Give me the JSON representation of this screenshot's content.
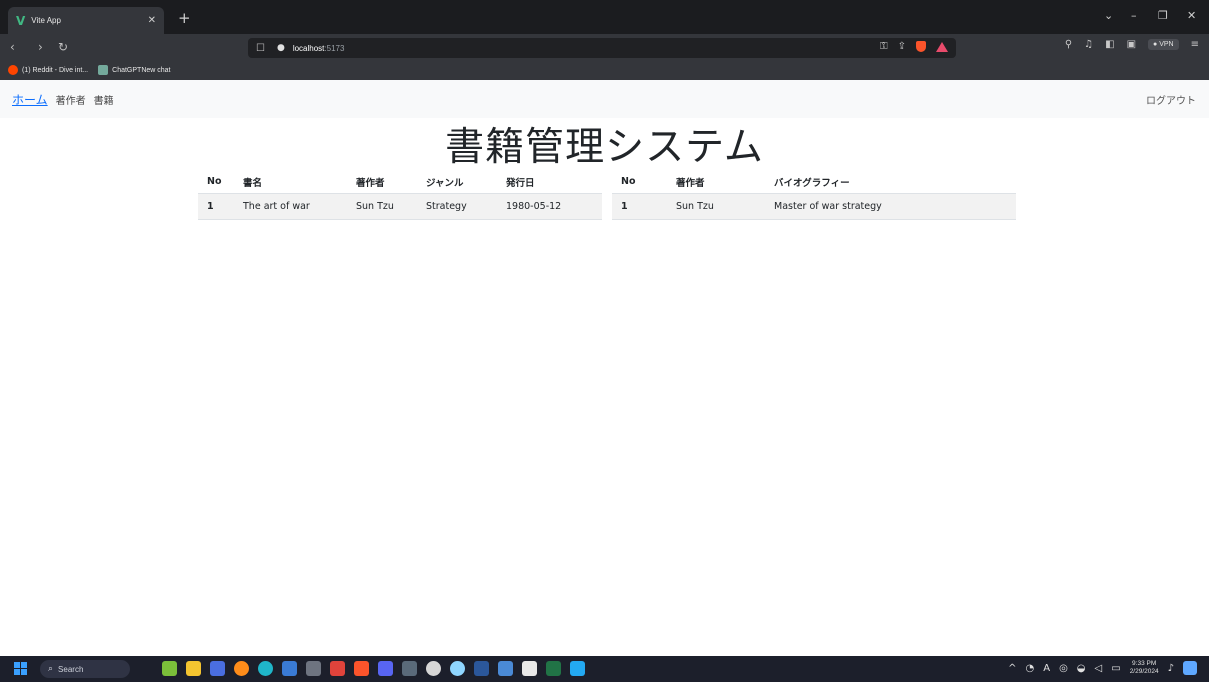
{
  "browser": {
    "tab_title": "Vite App",
    "url_host": "localhost",
    "url_port": ":5173",
    "vpn_label": "VPN",
    "bookmarks": [
      {
        "label": "(1) Reddit - Dive int..."
      },
      {
        "label": "ChatGPTNew chat"
      }
    ]
  },
  "nav": {
    "home": "ホーム",
    "authors": "著作者",
    "books": "書籍",
    "logout": "ログアウト"
  },
  "page_title": "書籍管理システム",
  "books_table": {
    "headers": [
      "No",
      "書名",
      "著作者",
      "ジャンル",
      "発行日"
    ],
    "rows": [
      [
        "1",
        "The art of war",
        "Sun Tzu",
        "Strategy",
        "1980-05-12"
      ]
    ]
  },
  "authors_table": {
    "headers": [
      "No",
      "著作者",
      "バイオグラフィー"
    ],
    "rows": [
      [
        "1",
        "Sun Tzu",
        "Master of war strategy"
      ]
    ]
  },
  "taskbar": {
    "search_label": "Search",
    "time": "9:33 PM",
    "date": "2/29/2024"
  },
  "colors": {
    "accent_link": "#0d6efd",
    "vue_green": "#41b883",
    "taskbar_bg": "#1c1f2b"
  }
}
